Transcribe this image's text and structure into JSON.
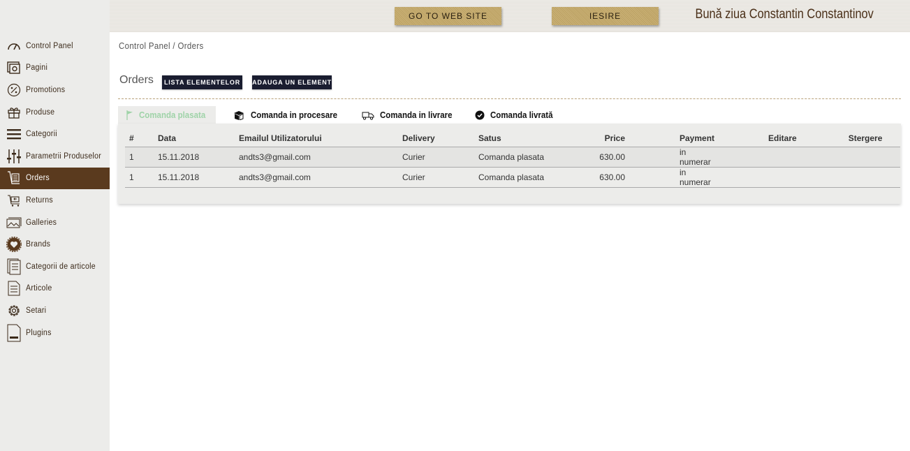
{
  "topbar": {
    "go_to_site": "GO TO WEB SITE",
    "exit": "IESIRE",
    "greeting": "Bună ziua Constantin Constantinov"
  },
  "sidebar": {
    "items": [
      {
        "label": "Control Panel",
        "icon": "gauge-icon"
      },
      {
        "label": "Pagini",
        "icon": "pages-icon"
      },
      {
        "label": "Promotions",
        "icon": "percent-icon"
      },
      {
        "label": "Produse",
        "icon": "gift-icon"
      },
      {
        "label": "Categorii",
        "icon": "menu-icon"
      },
      {
        "label": "Parametrii Produselor",
        "icon": "sliders-icon"
      },
      {
        "label": "Orders",
        "icon": "orders-icon",
        "active": true
      },
      {
        "label": "Returns",
        "icon": "returns-icon"
      },
      {
        "label": "Galleries",
        "icon": "gallery-icon"
      },
      {
        "label": "Brands",
        "icon": "badge-icon"
      },
      {
        "label": "Categorii de articole",
        "icon": "article-categories-icon"
      },
      {
        "label": "Articole",
        "icon": "document-icon"
      },
      {
        "label": "Setari",
        "icon": "gear-icon"
      },
      {
        "label": "Plugins",
        "icon": "plugin-icon"
      }
    ]
  },
  "breadcrumb": "Control Panel / Orders",
  "page": {
    "title": "Orders",
    "list_button": "LISTA ELEMENTELOR",
    "add_button": "ADAUGA UN ELEMENT"
  },
  "tabs": [
    {
      "label": "Comanda plasata",
      "icon": "flag-icon",
      "active": true
    },
    {
      "label": "Comanda in procesare",
      "icon": "box-icon"
    },
    {
      "label": "Comanda in livrare",
      "icon": "truck-icon"
    },
    {
      "label": "Comanda livrată",
      "icon": "check-circle-icon"
    }
  ],
  "table": {
    "headers": [
      "#",
      "Data",
      "Emailul Utilizatorului",
      "Delivery",
      "Satus",
      "Price",
      "Payment",
      "Editare",
      "Stergere"
    ],
    "rows": [
      [
        "1",
        "15.11.2018",
        "andts3@gmail.com",
        "Curier",
        "Comanda plasata",
        "630.00",
        "in numerar",
        "",
        ""
      ],
      [
        "1",
        "15.11.2018",
        "andts3@gmail.com",
        "Curier",
        "Comanda plasata",
        "630.00",
        "in numerar",
        "",
        ""
      ]
    ]
  },
  "colors": {
    "sidebar_active": "#5a3a1e",
    "gold": "#c4a866",
    "dark_button": "#1a1d30",
    "active_tab_text": "#9fd3a8"
  }
}
